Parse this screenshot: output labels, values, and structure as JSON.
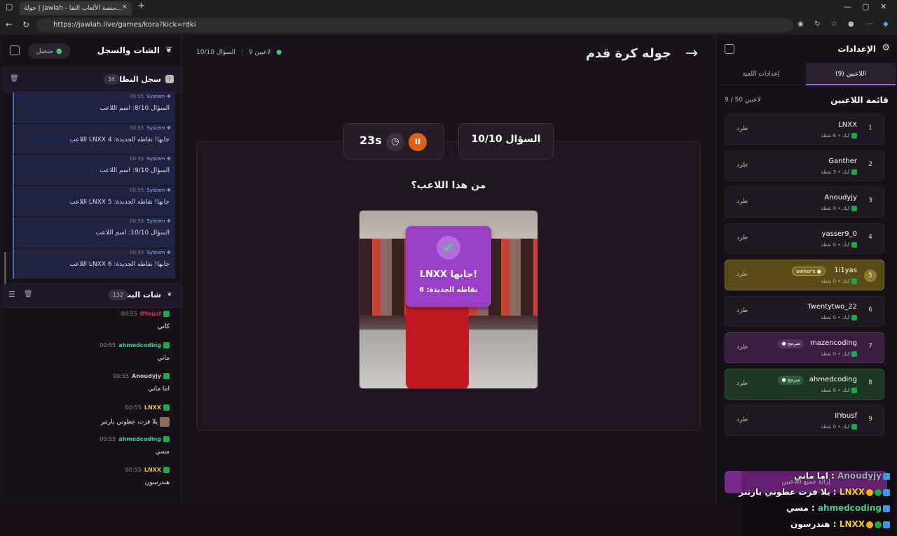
{
  "browser": {
    "tab_title": "جولة | Jawlah - منصة الألعاب التفا...",
    "url": "https://jawlah.live/games/kora?kick=rdki",
    "tab_close": "✕",
    "new_tab": "+"
  },
  "left_panel": {
    "title": "الشات والسجل",
    "status": "متصل",
    "system_log": {
      "title": "سجل النظام",
      "count": "34",
      "messages": [
        {
          "time": "00:55",
          "author": "System",
          "text": "السؤال 8/10: اسم اللاعب"
        },
        {
          "time": "00:55",
          "author": "System",
          "text": "اللاعب LNXX جابها! نقاطه الجديدة: 4"
        },
        {
          "time": "00:55",
          "author": "System",
          "text": "السؤال 9/10: اسم اللاعب"
        },
        {
          "time": "00:55",
          "author": "System",
          "text": "اللاعب LNXX جابها! نقاطه الجديدة: 5"
        },
        {
          "time": "00:55",
          "author": "System",
          "text": "السؤال 10/10: اسم اللاعب"
        },
        {
          "time": "00:55",
          "author": "System",
          "text": "اللاعب LNXX جابها! نقاطه الجديدة: 6"
        }
      ]
    },
    "stream_chat": {
      "title": "شات البث",
      "count": "132",
      "messages": [
        {
          "time": "00:55",
          "author": "IlYousf",
          "color": "#e0304a",
          "text": "كاتي"
        },
        {
          "time": "00:55",
          "author": "ahmedcoding",
          "color": "#3ed090",
          "text": "ماني"
        },
        {
          "time": "00:55",
          "author": "Anoudyjy",
          "color": "#c8c8d0",
          "text": "اما ماني"
        },
        {
          "time": "00:55",
          "author": "LNXX",
          "color": "#f0c030",
          "text": "يلا فزت عطوني بارتنر"
        },
        {
          "time": "00:55",
          "author": "ahmedcoding",
          "color": "#3ed090",
          "text": "مسي"
        },
        {
          "time": "00:55",
          "author": "LNXX",
          "color": "#f0c030",
          "text": "هندرسون"
        }
      ]
    }
  },
  "center": {
    "title": "جوله كرة قدم",
    "players_count": "9 لاعبين",
    "question_status": "السؤال 10/10",
    "timer": "23s",
    "pause_icon": "II",
    "question_card": "السؤال 10/10",
    "prompt": "من هذا اللاعب؟",
    "popup": {
      "line1": "LNXX جابها!",
      "line2": "نقاطه الجديدة: 6"
    }
  },
  "right_panel": {
    "title": "الإعدادات",
    "tab_players": "اللاعبين (9)",
    "tab_settings": "إعدادات اللعبة",
    "list_title": "قائمة اللاعبين",
    "list_count": "9 / 50 لاعبين",
    "kick_label": "طرد",
    "players": [
      {
        "num": "1",
        "name": "LNXX",
        "sub": "كيك • 6 نقطة",
        "style": "normal",
        "badge": ""
      },
      {
        "num": "2",
        "name": "Ganther",
        "sub": "كيك • 3 نقطة",
        "style": "normal",
        "badge": ""
      },
      {
        "num": "3",
        "name": "Anoudyjy",
        "sub": "كيك • 0 نقطة",
        "style": "normal",
        "badge": ""
      },
      {
        "num": "4",
        "name": "yasser9_0",
        "sub": "كيك • 0 نقطة",
        "style": "normal",
        "badge": ""
      },
      {
        "num": "5",
        "name": "1i1yas",
        "sub": "كيك • 0 نقطة",
        "style": "owner",
        "badge": "owner's ●"
      },
      {
        "num": "6",
        "name": "Twentytwo_22",
        "sub": "كيك • 0 نقطة",
        "style": "normal",
        "badge": ""
      },
      {
        "num": "7",
        "name": "mazencoding",
        "sub": "كيك • 0 نقطة",
        "style": "purple",
        "badge": "● مبرمج"
      },
      {
        "num": "8",
        "name": "ahmedcoding",
        "sub": "كيك • 0 نقطة",
        "style": "green",
        "badge": "● مبرمج"
      },
      {
        "num": "9",
        "name": "IlYousf",
        "sub": "كيك • 0 نقطة",
        "style": "normal",
        "badge": ""
      }
    ],
    "bottom_button": "إزالة جميع اللاعبين"
  },
  "overlay": {
    "lines": [
      {
        "name": "Anoudyjy",
        "text": "اما ماني :",
        "cls": "nm-d"
      },
      {
        "name": "LNXX",
        "text": "يلا فزت عطوني بارتنر :",
        "cls": "nm-y"
      },
      {
        "name": "ahmedcoding",
        "text": "مسي :",
        "cls": "nm-g"
      },
      {
        "name": "LNXX",
        "text": "هندرسون :",
        "cls": "nm-y"
      }
    ]
  }
}
